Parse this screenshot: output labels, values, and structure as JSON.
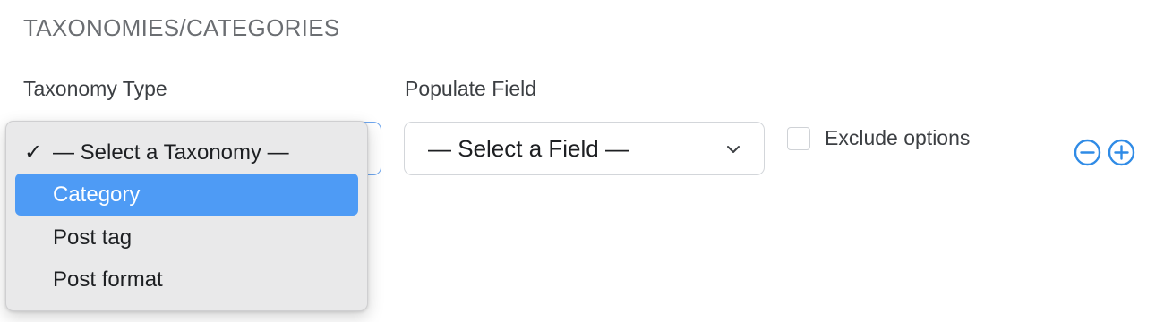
{
  "section": {
    "title": "TAXONOMIES/CATEGORIES"
  },
  "taxonomy": {
    "label": "Taxonomy Type",
    "options": [
      {
        "label": "— Select a Taxonomy —",
        "checked": true,
        "highlighted": false
      },
      {
        "label": "Category",
        "checked": false,
        "highlighted": true
      },
      {
        "label": "Post tag",
        "checked": false,
        "highlighted": false
      },
      {
        "label": "Post format",
        "checked": false,
        "highlighted": false
      }
    ],
    "check_glyph": "✓"
  },
  "populate": {
    "label": "Populate Field",
    "selected": "— Select a Field —",
    "icon": "chevron-down-icon"
  },
  "exclude": {
    "label": "Exclude options",
    "checked": false
  },
  "actions": {
    "remove_icon": "minus-circle-icon",
    "add_icon": "plus-circle-icon",
    "accent_color": "#2f8be6"
  },
  "colors": {
    "highlight": "#4e9bf5",
    "focus_border": "#6ea6ee"
  }
}
